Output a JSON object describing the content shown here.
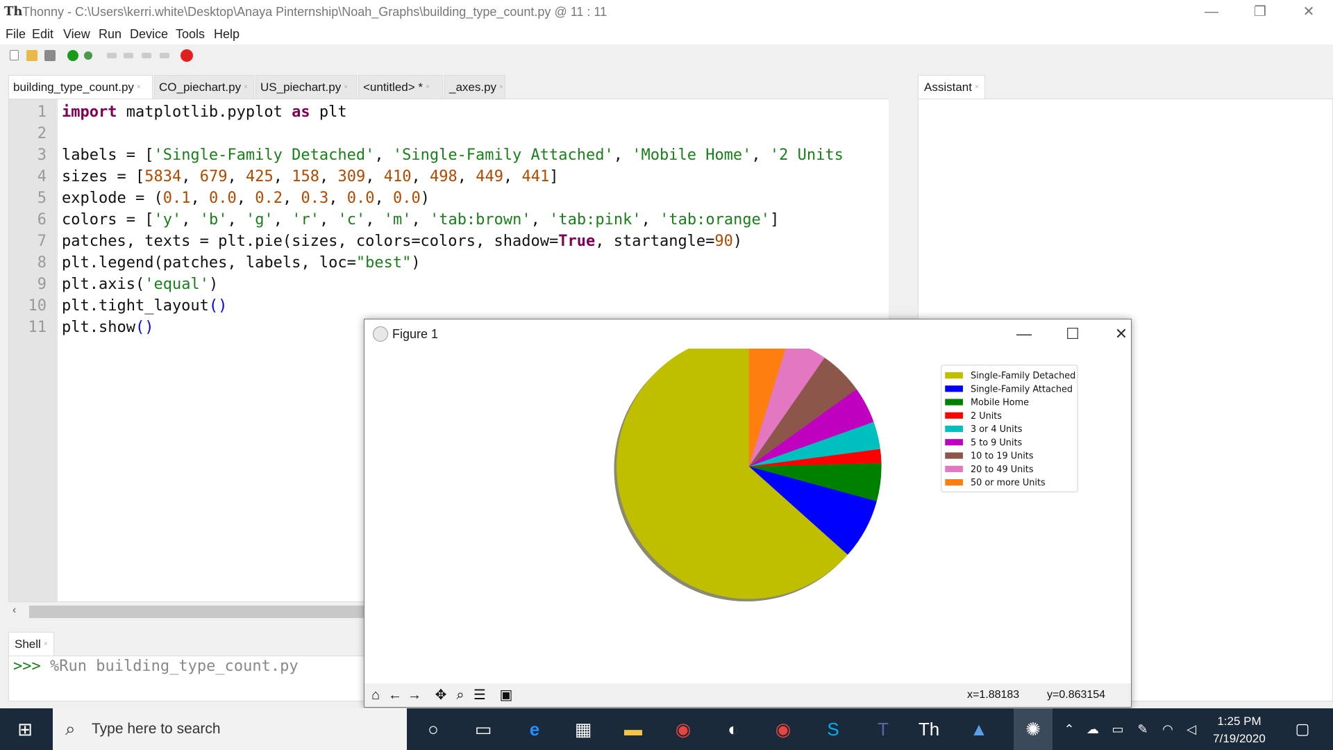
{
  "window": {
    "app": "Thonny",
    "path": "C:\\Users\\kerri.white\\Desktop\\Anaya Pinternship\\Noah_Graphs\\building_type_count.py",
    "cursor": "@  11 : 11",
    "minimize": "—",
    "restore": "❐",
    "close": "✕"
  },
  "menu": [
    "File",
    "Edit",
    "View",
    "Run",
    "Device",
    "Tools",
    "Help"
  ],
  "tabs": [
    {
      "label": "building_type_count.py",
      "active": true
    },
    {
      "label": "CO_piechart.py",
      "active": false
    },
    {
      "label": "US_piechart.py",
      "active": false
    },
    {
      "label": "<untitled> *",
      "active": false
    },
    {
      "label": "_axes.py",
      "active": false
    }
  ],
  "tab_close": "×",
  "line_numbers": [
    "1",
    "2",
    "3",
    "4",
    "5",
    "6",
    "7",
    "8",
    "9",
    "10",
    "11"
  ],
  "code_lines": [
    "import matplotlib.pyplot as plt",
    "",
    "labels = ['Single-Family Detached', 'Single-Family Attached', 'Mobile Home', '2 Units",
    "sizes = [5834, 679, 425, 158, 309, 410, 498, 449, 441]",
    "explode = (0.1, 0.0, 0.2, 0.3, 0.0, 0.0)",
    "colors = ['y', 'b', 'g', 'r', 'c', 'm', 'tab:brown', 'tab:pink', 'tab:orange']",
    "patches, texts = plt.pie(sizes, colors=colors, shadow=True, startangle=90)",
    "plt.legend(patches, labels, loc=\"best\")",
    "plt.axis('equal')",
    "plt.tight_layout()",
    "plt.show()"
  ],
  "shell": {
    "tab_label": "Shell",
    "prompt": ">>> ",
    "command": "%Run building_type_count.py"
  },
  "assistant": {
    "tab_label": "Assistant"
  },
  "figure": {
    "title": "Figure 1",
    "minimize": "—",
    "maximize": "☐",
    "close": "✕",
    "coords_x": "x=1.88183",
    "coords_y": "y=0.863154"
  },
  "chart_data": {
    "type": "pie",
    "categories": [
      "Single-Family Detached",
      "Single-Family Attached",
      "Mobile Home",
      "2 Units",
      "3 or 4 Units",
      "5 to 9 Units",
      "10 to 19 Units",
      "20 to 49 Units",
      "50 or more Units"
    ],
    "values": [
      5834,
      679,
      425,
      158,
      309,
      410,
      498,
      449,
      441
    ],
    "colors": [
      "#bfbf00",
      "#0000ff",
      "#008000",
      "#ff0000",
      "#00bfbf",
      "#bf00bf",
      "#8c564b",
      "#e377c2",
      "#ff7f0e"
    ],
    "startangle": 90,
    "shadow": true,
    "legend": "top-right"
  },
  "taskbar": {
    "search_placeholder": "Type here to search",
    "time": "1:25 PM",
    "date": "7/19/2020"
  }
}
